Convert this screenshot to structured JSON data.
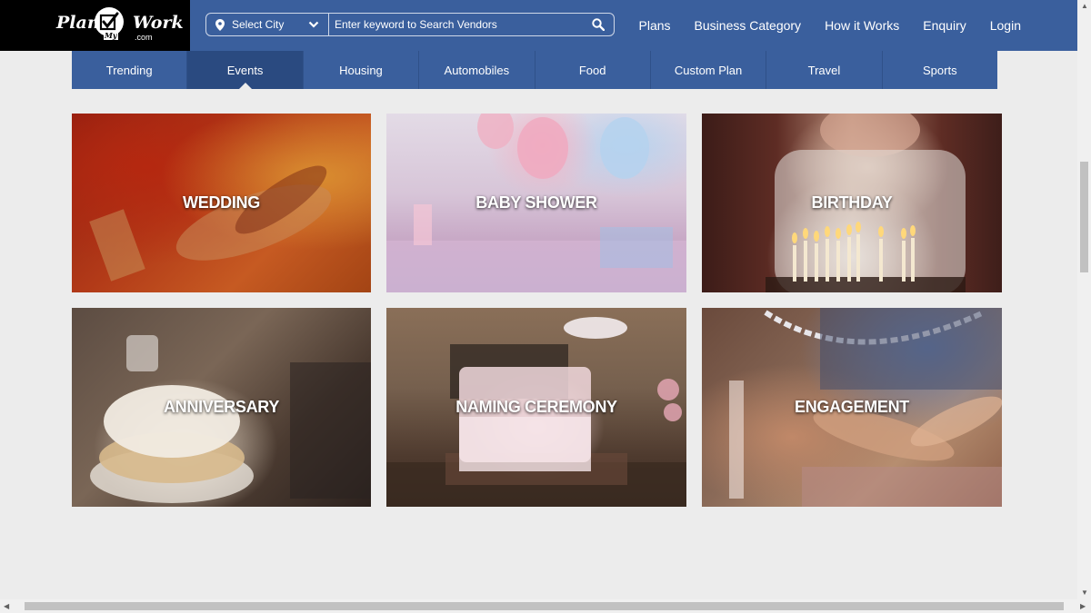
{
  "brand": {
    "word1": "Plan",
    "word2": "Work",
    "my": "My",
    "dotcom": ".com"
  },
  "search": {
    "city_label": "Select City",
    "keyword_placeholder": "Enter keyword to Search Vendors"
  },
  "nav": [
    {
      "label": "Plans"
    },
    {
      "label": "Business Category"
    },
    {
      "label": "How it Works"
    },
    {
      "label": "Enquiry"
    },
    {
      "label": "Login"
    }
  ],
  "tabs": [
    {
      "label": "Trending"
    },
    {
      "label": "Events",
      "active": true
    },
    {
      "label": "Housing"
    },
    {
      "label": "Automobiles"
    },
    {
      "label": "Food"
    },
    {
      "label": "Custom Plan"
    },
    {
      "label": "Travel"
    },
    {
      "label": "Sports"
    }
  ],
  "cards": [
    {
      "label": "WEDDING"
    },
    {
      "label": "BABY SHOWER"
    },
    {
      "label": "BIRTHDAY"
    },
    {
      "label": "ANNIVERSARY"
    },
    {
      "label": "NAMING CEREMONY"
    },
    {
      "label": "ENGAGEMENT"
    }
  ],
  "colors": {
    "header_blue": "#3a5f9d",
    "active_tab": "#2a4a80",
    "page_bg": "#ececec"
  },
  "icons": [
    "map-pin-icon",
    "chevron-down-icon",
    "search-icon",
    "checkmark-icon"
  ]
}
